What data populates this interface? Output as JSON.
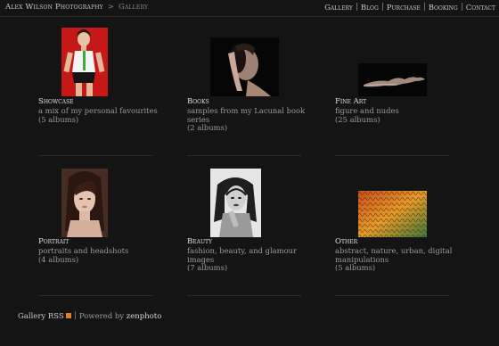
{
  "header": {
    "site_title": "Alex Wilson Photography",
    "separator": ">",
    "current": "Gallery",
    "nav": [
      "Gallery",
      "Blog",
      "Purchase",
      "Booking",
      "Contact"
    ]
  },
  "albums": [
    {
      "title": "Showcase",
      "description": "a mix of my personal favourites",
      "count": "(5 albums)"
    },
    {
      "title": "Books",
      "description": "samples from my Lacunal book series",
      "count": "(2 albums)"
    },
    {
      "title": "Fine Art",
      "description": "figure and nudes",
      "count": "(25 albums)"
    },
    {
      "title": "Portrait",
      "description": "portraits and headshots",
      "count": "(4 albums)"
    },
    {
      "title": "Beauty",
      "description": "fashion, beauty, and glamour images",
      "count": "(7 albums)"
    },
    {
      "title": "Other",
      "description": "abstract, nature, urban, digital manipulations",
      "count": "(5 albums)"
    }
  ],
  "footer": {
    "rss_label": "Gallery RSS",
    "powered_label": "Powered by",
    "brand": "zenphoto"
  },
  "colors": {
    "background": "#141414",
    "link": "#c9c9c9",
    "text": "#9a9a9a",
    "rss": "#e37e25"
  }
}
